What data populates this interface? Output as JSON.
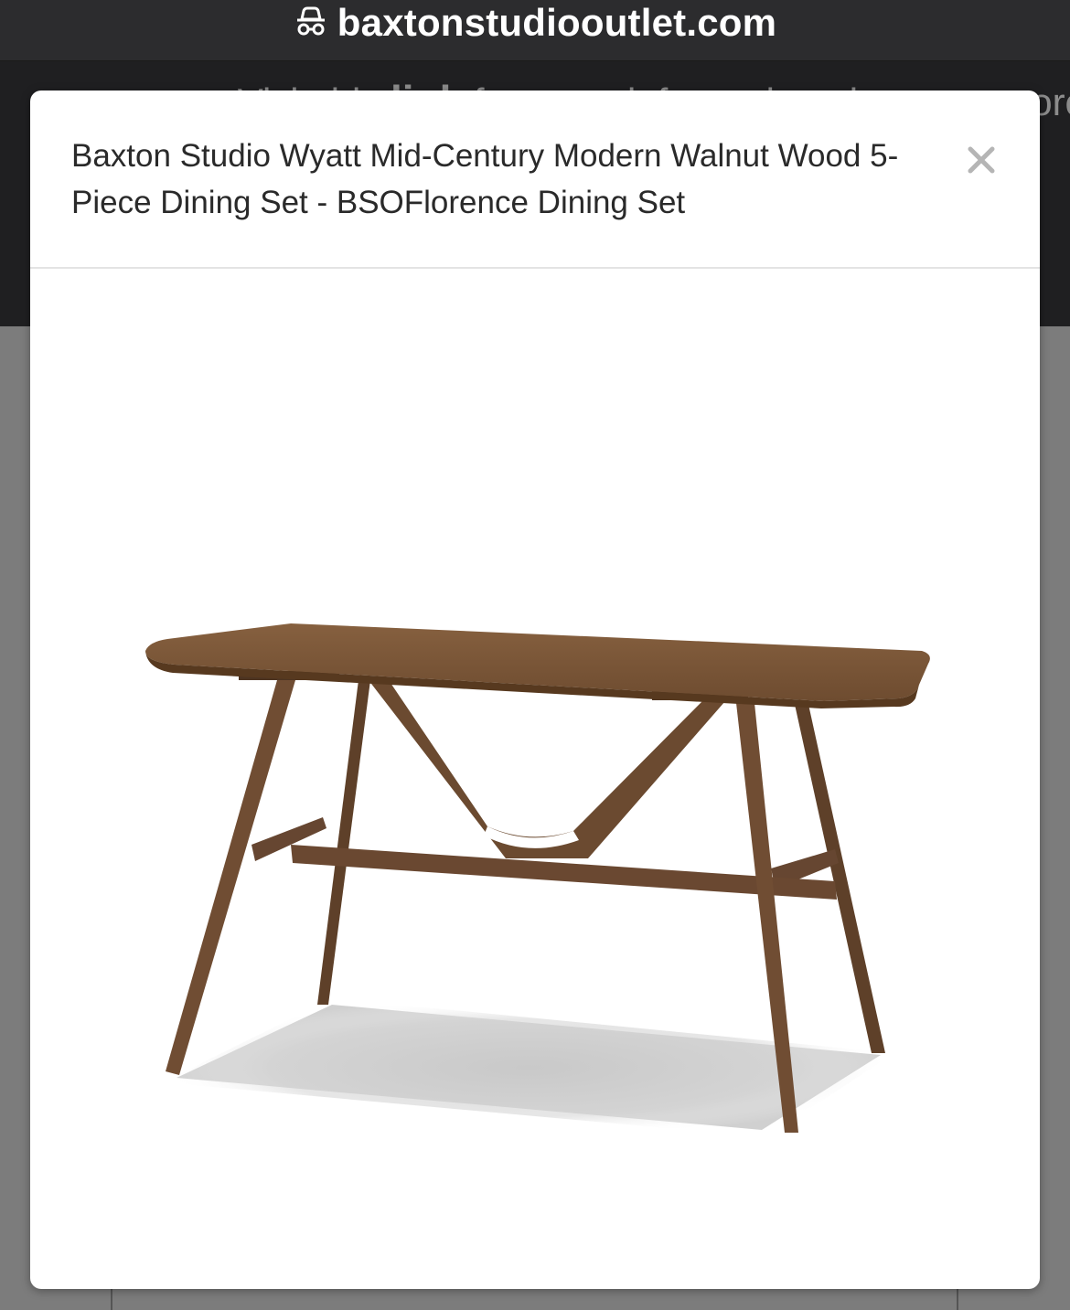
{
  "browser": {
    "url": "baxtonstudiooutlet.com",
    "lock_icon": "privacy-lock-icon"
  },
  "site": {
    "banner_prefix": "stores. Visit this ",
    "banner_link": "link",
    "banner_suffix": " for more information about our store"
  },
  "modal": {
    "title": "Baxton Studio Wyatt Mid-Century Modern Walnut Wood 5-Piece Dining Set - BSOFlorence Dining Set",
    "close_icon": "close-icon",
    "image_subject": "walnut-dining-table"
  },
  "colors": {
    "wood": "#6b4a30",
    "wood_light": "#7d583a",
    "shadow": "#c9c9c9",
    "close": "#b5b5b5"
  }
}
